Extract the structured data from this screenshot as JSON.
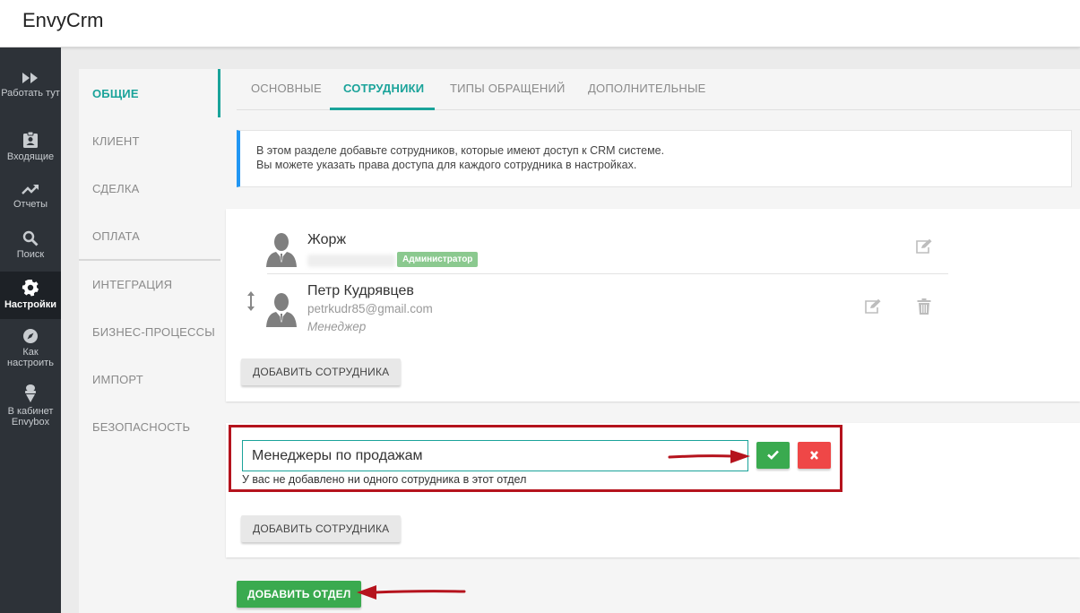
{
  "app": {
    "title": "EnvyCrm"
  },
  "rail": [
    {
      "icon": "fast-forward-icon",
      "label": "Работать тут"
    },
    {
      "icon": "clipboard-icon",
      "label": "Входящие"
    },
    {
      "icon": "trending-up-icon",
      "label": "Отчеты"
    },
    {
      "icon": "search-icon",
      "label": "Поиск"
    },
    {
      "icon": "gear-icon",
      "label": "Настройки",
      "active": true
    },
    {
      "icon": "compass-icon",
      "label": "Как настроить"
    },
    {
      "icon": "ice-cream-icon",
      "label": "В кабинет Envybox"
    }
  ],
  "leftnav": {
    "items": [
      "ОБЩИЕ",
      "КЛИЕНТ",
      "СДЕЛКА",
      "ОПЛАТА",
      "ИНТЕГРАЦИЯ",
      "БИЗНЕС-ПРОЦЕССЫ",
      "ИМПОРТ",
      "БЕЗОПАСНОСТЬ"
    ],
    "active": "ОБЩИЕ"
  },
  "tabs": {
    "items": [
      "ОСНОВНЫЕ",
      "СОТРУДНИКИ",
      "ТИПЫ ОБРАЩЕНИЙ",
      "ДОПОЛНИТЕЛЬНЫЕ"
    ],
    "active": "СОТРУДНИКИ"
  },
  "info": {
    "line1": "В этом разделе добавьте сотрудников, которые имеют доступ к CRM системе.",
    "line2": "Вы можете указать права доступа для каждого сотрудника в настройках."
  },
  "employees": [
    {
      "name": "Жорж",
      "email": "",
      "badge": "Администратор",
      "role": ""
    },
    {
      "name": "Петр Кудрявцев",
      "email": "petrkudr85@gmail.com",
      "badge": "",
      "role": "Менеджер"
    }
  ],
  "buttons": {
    "add_employee": "ДОБАВИТЬ СОТРУДНИКА",
    "add_department": "ДОБАВИТЬ ОТДЕЛ"
  },
  "department": {
    "name_value": "Менеджеры по продажам",
    "empty_hint": "У вас не добавлено ни одного сотрудника в этот отдел"
  },
  "colors": {
    "accent": "#1aa39a",
    "sidebar": "#2d3238",
    "confirm": "#3aaa4f",
    "cancel": "#ef4747",
    "highlight": "#b5131d",
    "badge": "#8bc98f",
    "info_border": "#2196f3"
  }
}
